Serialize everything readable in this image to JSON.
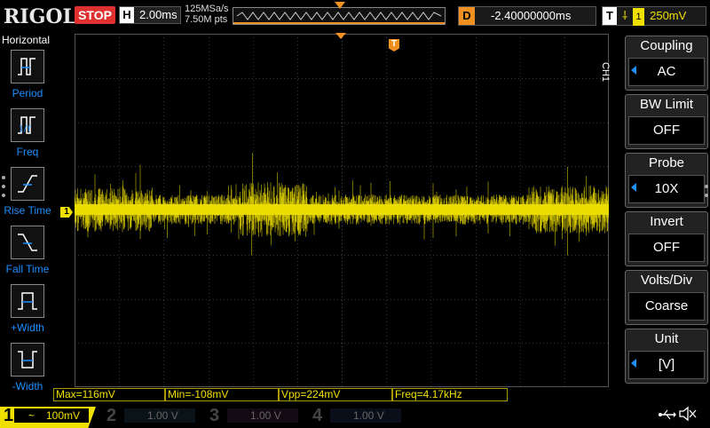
{
  "top": {
    "brand": "RIGOL",
    "run_status": "STOP",
    "horizontal_key": "H",
    "timebase": "2.00ms",
    "sample_rate": "125MSa/s",
    "memory_depth": "7.50M pts",
    "delay_key": "D",
    "delay_value": "-2.40000000ms",
    "trigger_key": "T",
    "trigger_source": "1",
    "trigger_level": "250mV"
  },
  "left_menu": {
    "title": "Horizontal",
    "items": [
      {
        "label": "Period",
        "icon": "period-icon"
      },
      {
        "label": "Freq",
        "icon": "freq-icon"
      },
      {
        "label": "Rise Time",
        "icon": "rise-time-icon"
      },
      {
        "label": "Fall Time",
        "icon": "fall-time-icon"
      },
      {
        "label": "+Width",
        "icon": "positive-width-icon"
      },
      {
        "label": "-Width",
        "icon": "negative-width-icon"
      }
    ]
  },
  "channel_tag": "CH1",
  "right_menu": {
    "items": [
      {
        "title": "Coupling",
        "value": "AC",
        "has_arrow": true
      },
      {
        "title": "BW Limit",
        "value": "OFF",
        "has_arrow": false
      },
      {
        "title": "Probe",
        "value": "10X",
        "has_arrow": true
      },
      {
        "title": "Invert",
        "value": "OFF",
        "has_arrow": false
      },
      {
        "title": "Volts/Div",
        "value": "Coarse",
        "has_arrow": false
      },
      {
        "title": "Unit",
        "value": "[V]",
        "has_arrow": true
      }
    ]
  },
  "measurements": {
    "max": "Max=116mV",
    "min": "Min=-108mV",
    "vpp": "Vpp=224mV",
    "freq": "Freq=4.17kHz"
  },
  "channels": [
    {
      "num": "1",
      "coupling_symbol": "~",
      "scale": "100mV",
      "active": true
    },
    {
      "num": "2",
      "scale": "1.00 V",
      "active": false
    },
    {
      "num": "3",
      "scale": "1.00 V",
      "active": false
    },
    {
      "num": "4",
      "scale": "1.00 V",
      "active": false
    }
  ],
  "ch1_marker": "1",
  "trigger_marker": "T",
  "colors": {
    "ch1": "#f0e000",
    "ch2": "#00b0d0",
    "ch3": "#d030d0",
    "ch4": "#3070ff",
    "accent": "#1e90ff",
    "trigger": "#f09020",
    "stop": "#e03030"
  }
}
